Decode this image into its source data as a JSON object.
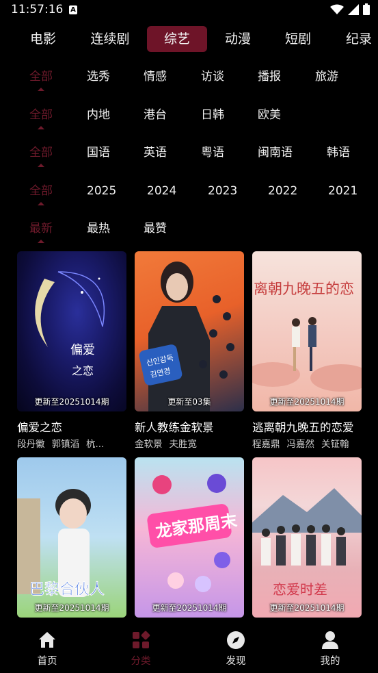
{
  "status": {
    "time": "11:57:16",
    "notif": "A"
  },
  "top_tabs": [
    "电影",
    "连续剧",
    "综艺",
    "动漫",
    "短剧",
    "纪录"
  ],
  "active_tab_index": 2,
  "filters": [
    {
      "items": [
        "全部",
        "选秀",
        "情感",
        "访谈",
        "播报",
        "旅游"
      ],
      "selected": 0
    },
    {
      "items": [
        "全部",
        "内地",
        "港台",
        "日韩",
        "欧美"
      ],
      "selected": 0
    },
    {
      "items": [
        "全部",
        "国语",
        "英语",
        "粤语",
        "闽南语",
        "韩语"
      ],
      "selected": 0
    },
    {
      "items": [
        "全部",
        "2025",
        "2024",
        "2023",
        "2022",
        "2021"
      ],
      "selected": 0
    },
    {
      "items": [
        "最新",
        "最热",
        "最赞"
      ],
      "selected": 0
    }
  ],
  "cards": [
    {
      "title": "偏爱之恋",
      "cast": [
        "段丹徽",
        "郭镇滔",
        "杭..."
      ],
      "update": "更新至20251014期"
    },
    {
      "title": "新人教练金软景",
      "cast": [
        "金软景",
        "夫胜宽"
      ],
      "update": "更新至03集"
    },
    {
      "title": "逃离朝九晚五的恋爱",
      "cast": [
        "程嘉鼎",
        "冯嘉然",
        "关钲翰"
      ],
      "update": "更新至20251014期"
    },
    {
      "title": "",
      "cast": [],
      "update": "更新至20251014期"
    },
    {
      "title": "",
      "cast": [],
      "update": "更新至20251014期"
    },
    {
      "title": "",
      "cast": [],
      "update": "更新至20251014期"
    }
  ],
  "nav": [
    {
      "label": "首页",
      "icon": "home-icon"
    },
    {
      "label": "分类",
      "icon": "category-icon"
    },
    {
      "label": "发现",
      "icon": "compass-icon"
    },
    {
      "label": "我的",
      "icon": "user-icon"
    }
  ],
  "active_nav_index": 1,
  "colors": {
    "accent": "#6e1428",
    "background": "#000000"
  }
}
